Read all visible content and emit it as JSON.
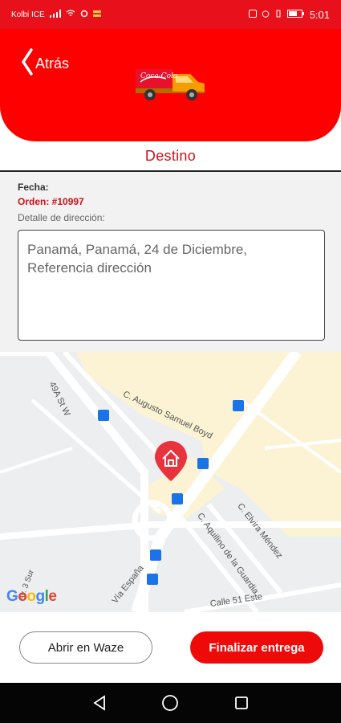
{
  "status_bar": {
    "carrier": "Kolbi ICE",
    "battery": "60",
    "time": "5:01"
  },
  "header": {
    "back_label": "Atrás",
    "truck_brand": "Coca-Cola"
  },
  "destination": {
    "title": "Destino"
  },
  "order": {
    "fecha_label": "Fecha:",
    "orden_label": "Orden: #10997",
    "detalle_label": "Detalle de dirección:",
    "address_text": "Panamá, Panamá, 24 de Diciembre, Referencia dirección"
  },
  "map": {
    "streets": [
      "49A St W",
      "C. Augusto Samuel Boyd",
      "C. Elvira Méndez",
      "C. Aquilino de la Guardia",
      "Vía España",
      "Calle 51 Este",
      "Av. 3 Sur"
    ],
    "logo": "Google"
  },
  "actions": {
    "waze_label": "Abrir en Waze",
    "finish_label": "Finalizar entrega"
  },
  "colors": {
    "brand_red": "#ff0000",
    "accent_red": "#d0101a",
    "map_yellow": "#fbf3d3"
  }
}
